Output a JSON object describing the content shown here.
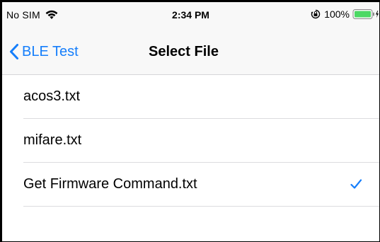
{
  "status_bar": {
    "carrier": "No SIM",
    "time": "2:34 PM",
    "battery_percent": "100%",
    "battery_level": 1.0,
    "icons": [
      "wifi-icon",
      "orientation-lock-icon",
      "battery-icon",
      "charging-icon"
    ]
  },
  "nav_bar": {
    "back_label": "BLE Test",
    "title": "Select File",
    "accent_color": "#157efb"
  },
  "files": [
    {
      "name": "acos3.txt",
      "selected": false
    },
    {
      "name": "mifare.txt",
      "selected": false
    },
    {
      "name": "Get Firmware Command.txt",
      "selected": true
    }
  ]
}
